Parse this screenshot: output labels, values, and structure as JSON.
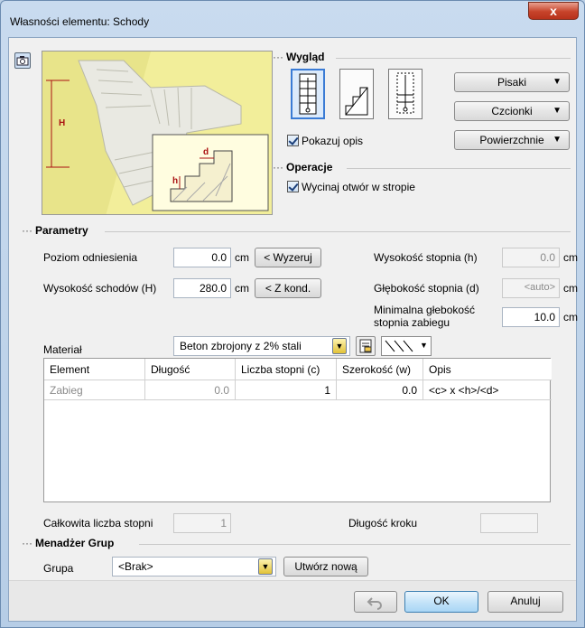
{
  "window": {
    "title": "Własności elementu: Schody",
    "close_glyph": "x"
  },
  "preview": {
    "label_h_big": "H",
    "label_h_small": "h",
    "label_d": "d",
    "camera_icon": "camera-icon"
  },
  "appearance": {
    "heading": "Wygląd",
    "stair_types": [
      "straight-stair-icon",
      "side-view-stair-icon",
      "dashed-stair-icon"
    ],
    "selected_type": 0,
    "show_desc_label": "Pokazuj opis",
    "show_desc_checked": true,
    "buttons": {
      "pens": "Pisaki",
      "fonts": "Czcionki",
      "surfaces": "Powierzchnie"
    }
  },
  "operations": {
    "heading": "Operacje",
    "cut_hole_label": "Wycinaj otwór w stropie",
    "cut_hole_checked": true
  },
  "params": {
    "heading": "Parametry",
    "ref_level_label": "Poziom odniesienia",
    "ref_level_value": "0.0",
    "ref_level_unit": "cm",
    "reset_button": "< Wyzeruj",
    "stairs_height_label": "Wysokość schodów (H)",
    "stairs_height_value": "280.0",
    "stairs_height_unit": "cm",
    "zkond_button": "< Z kond.",
    "step_height_label": "Wysokość stopnia (h)",
    "step_height_value": "0.0",
    "step_height_unit": "cm",
    "step_depth_label": "Głębokość stopnia (d)",
    "step_depth_value": "<auto>",
    "step_depth_unit": "cm",
    "min_depth_label_1": "Minimalna głebokość",
    "min_depth_label_2": "stopnia zabiegu",
    "min_depth_value": "10.0",
    "min_depth_unit": "cm",
    "material_label": "Materiał",
    "material_value": "Beton zbrojony z 2% stali"
  },
  "table": {
    "columns": [
      "Element",
      "Długość",
      "Liczba stopni (c)",
      "Szerokość (w)",
      "Opis"
    ],
    "rows": [
      [
        "Zabieg",
        "0.0",
        "1",
        "0.0",
        "<c> x <h>/<d>"
      ]
    ]
  },
  "totals": {
    "total_steps_label": "Całkowita liczba stopni",
    "total_steps_value": "1",
    "step_length_label": "Długość kroku",
    "step_length_value": ""
  },
  "groups": {
    "heading": "Menadżer Grup",
    "group_label": "Grupa",
    "group_value": "<Brak>",
    "create_button": "Utwórz nową"
  },
  "footer": {
    "ok": "OK",
    "cancel": "Anuluj"
  }
}
